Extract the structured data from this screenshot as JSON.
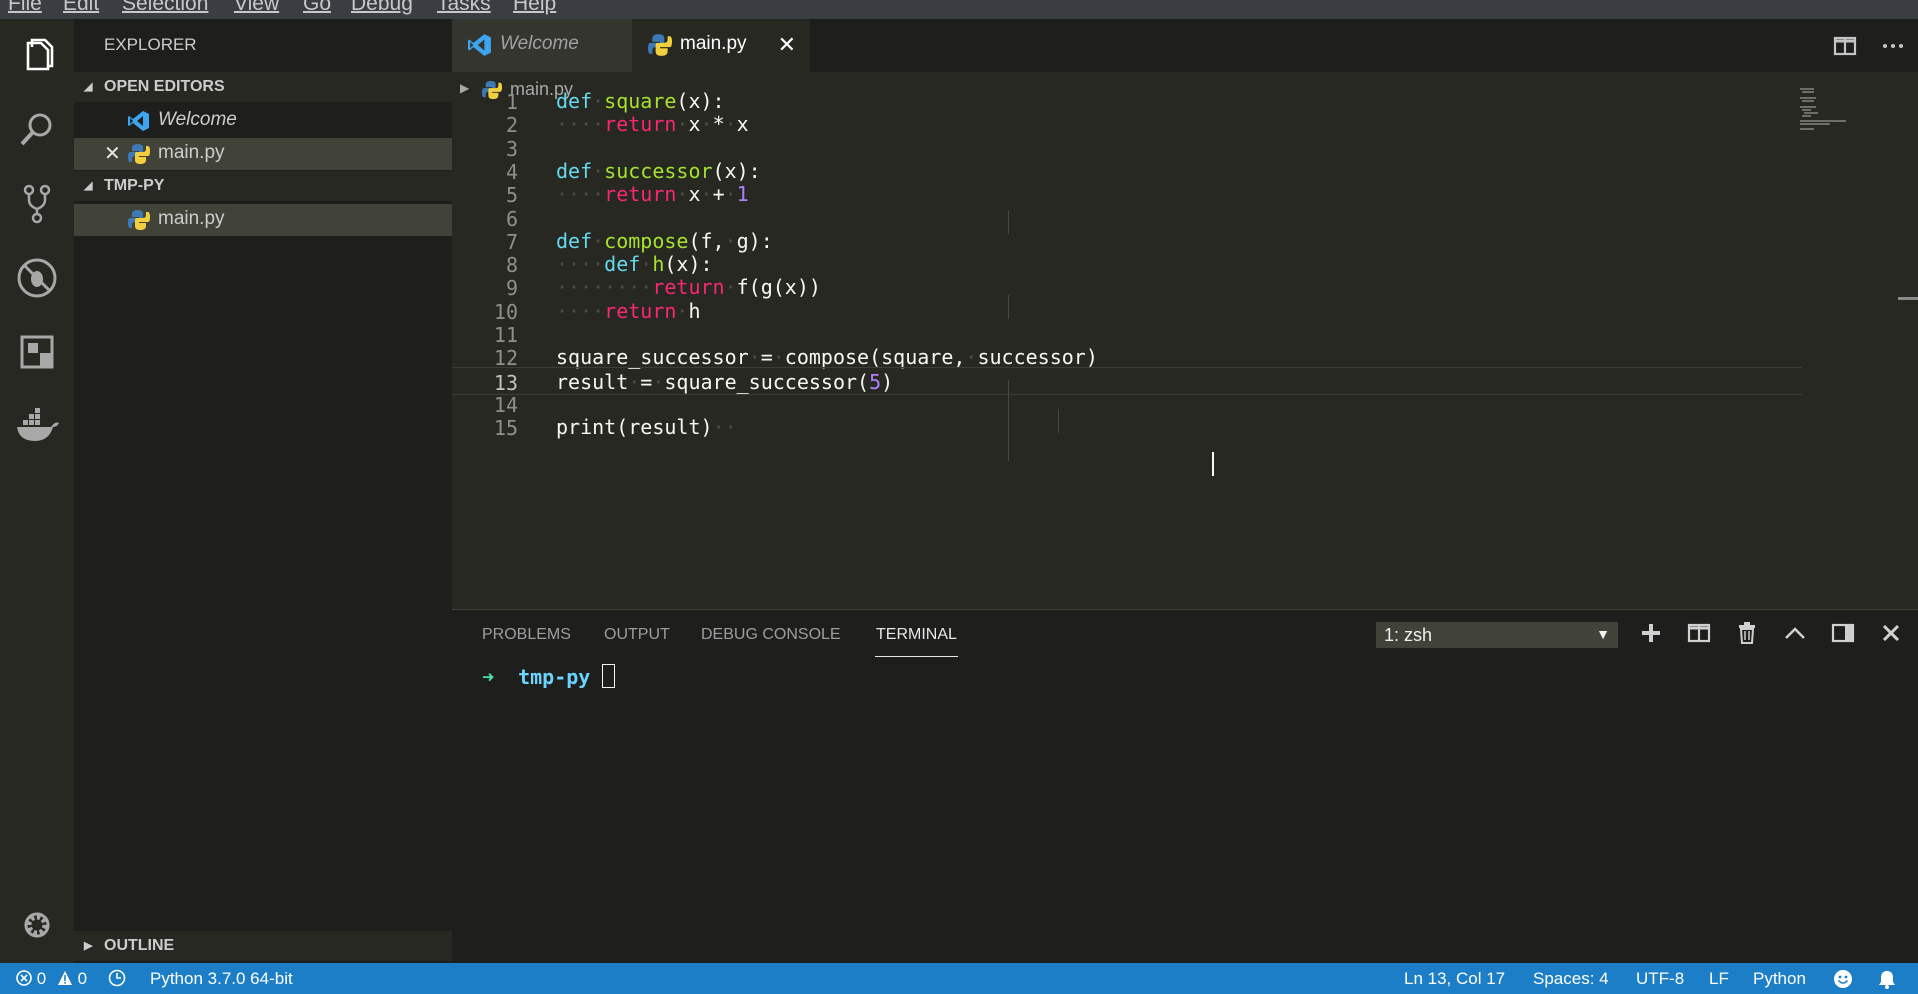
{
  "menu": [
    "File",
    "Edit",
    "Selection",
    "View",
    "Go",
    "Debug",
    "Tasks",
    "Help"
  ],
  "activity_bar": [
    "files-icon",
    "search-icon",
    "source-control-icon",
    "debug-icon",
    "extensions-icon",
    "docker-icon",
    "gear-icon"
  ],
  "sidebar": {
    "title": "EXPLORER",
    "open_editors": {
      "header": "OPEN EDITORS",
      "items": [
        {
          "label": "Welcome",
          "icon": "vscode-icon",
          "italic": true
        },
        {
          "label": "main.py",
          "icon": "python-icon",
          "dirty_close": "✕"
        }
      ]
    },
    "folder": {
      "header": "TMP-PY",
      "items": [
        {
          "label": "main.py",
          "icon": "python-icon"
        }
      ]
    },
    "outline": {
      "header": "OUTLINE"
    }
  },
  "tabs": [
    {
      "label": "Welcome",
      "icon": "vscode-icon",
      "italic": true,
      "active": false
    },
    {
      "label": "main.py",
      "icon": "python-icon",
      "active": true,
      "close": "✕"
    }
  ],
  "editor": {
    "breadcrumb": "main.py",
    "current_line": 13,
    "lines": [
      "def square(x):",
      "    return x * x",
      "",
      "def successor(x):",
      "    return x + 1",
      "",
      "def compose(f, g):",
      "    def h(x):",
      "        return f(g(x))",
      "    return h",
      "",
      "square_successor = compose(square, successor)",
      "result = square_successor(5)",
      "",
      "print(result)  "
    ]
  },
  "panel": {
    "tabs": [
      "PROBLEMS",
      "OUTPUT",
      "DEBUG CONSOLE",
      "TERMINAL"
    ],
    "active_tab": "TERMINAL",
    "terminal_select": "1: zsh",
    "terminal": {
      "arrow": "➜",
      "dir": "tmp-py"
    }
  },
  "status": {
    "errors": "0",
    "warnings": "0",
    "interpreter": "Python 3.7.0 64-bit",
    "position": "Ln 13, Col 17",
    "spaces": "Spaces: 4",
    "encoding": "UTF-8",
    "eol": "LF",
    "language": "Python"
  },
  "colors": {
    "status_bar": "#1b7ec6",
    "editor_bg": "#272822",
    "keyword": "#66d9ef",
    "return_keyword": "#f92672",
    "function": "#a6e22e",
    "number": "#ae81ff"
  }
}
